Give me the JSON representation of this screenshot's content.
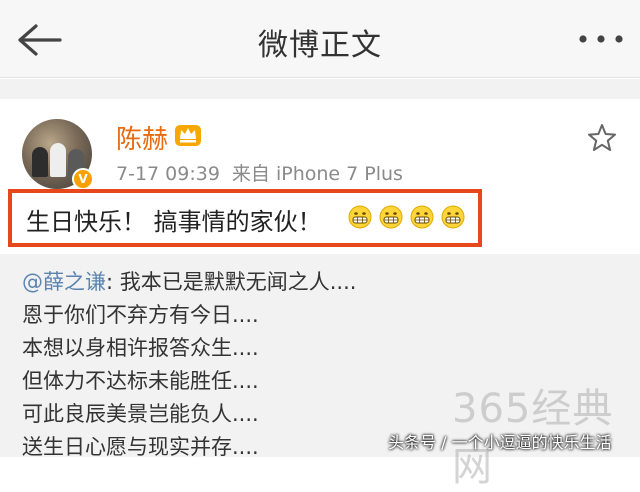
{
  "nav": {
    "title": "微博正文",
    "back_icon": "arrow-left-icon",
    "more_icon": "more-dots-icon"
  },
  "post": {
    "username": "陈赫",
    "badge_icon": "crown-icon",
    "verified_mark": "V",
    "time": "7-17 09:39",
    "source": "来自 iPhone 7 Plus",
    "text": "生日快乐！ 搞事情的家伙！",
    "emoji_count": 4,
    "highlight_color": "#e8471b",
    "name_color": "#e86b0f"
  },
  "repost": {
    "mention": "@薛之谦",
    "first_line_rest": ": 我本已是默默无闻之人....",
    "lines": [
      "恩于你们不弃方有今日....",
      "本想以身相许报答众生....",
      "但体力不达标未能胜任....",
      "可此良辰美景岂能负人....",
      "送生日心愿与现实并存...."
    ],
    "mention_color": "#5b84b0"
  },
  "watermark": "365经典网",
  "attribution": "头条号 / 一个小逗逼的快乐生活"
}
